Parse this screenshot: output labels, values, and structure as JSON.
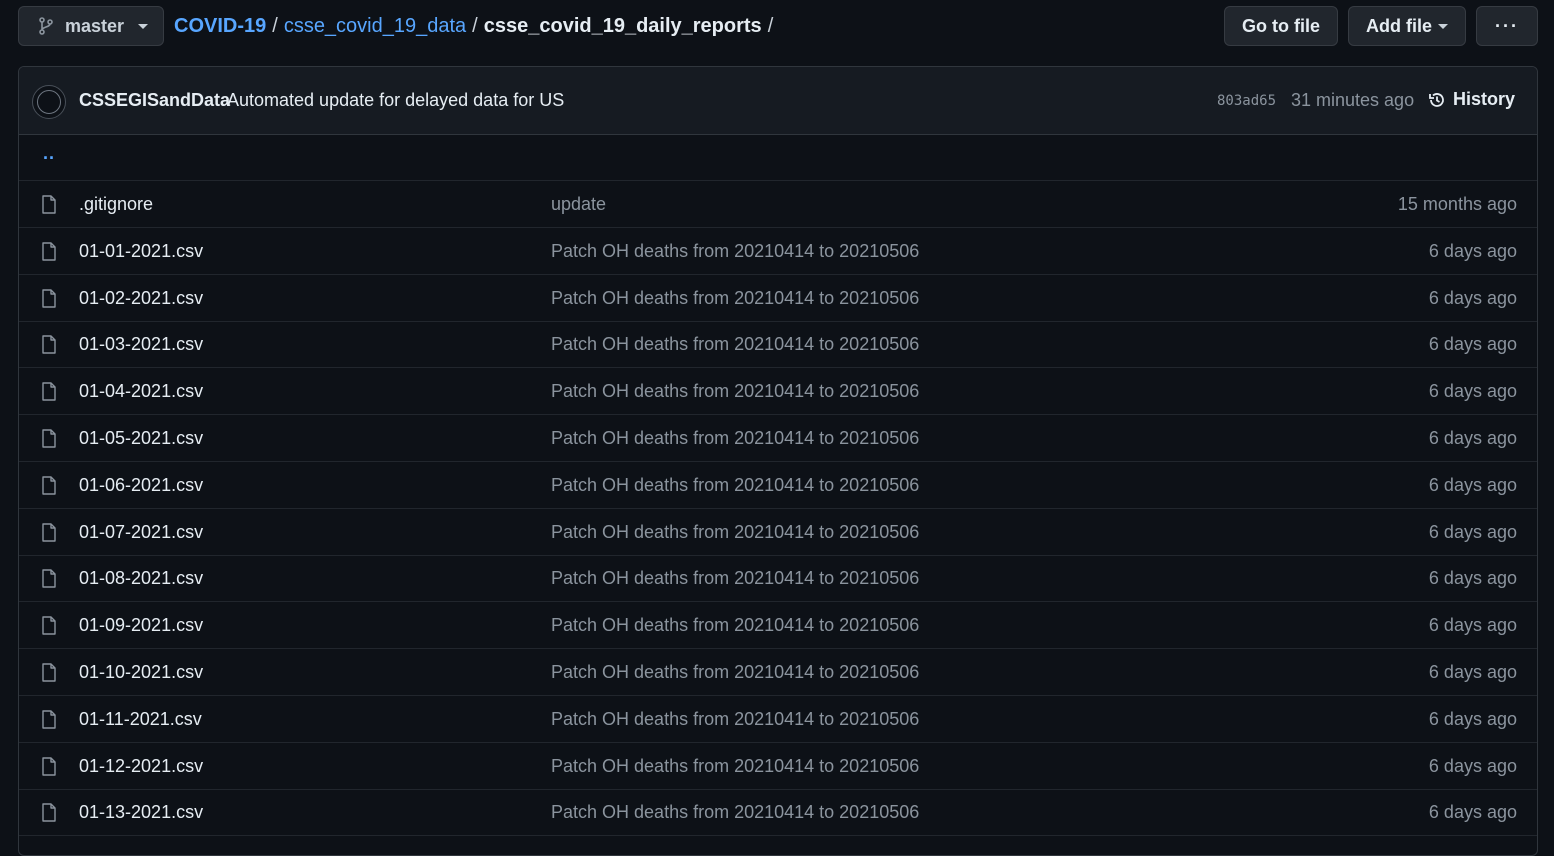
{
  "toolbar": {
    "branch": "master",
    "breadcrumb": {
      "root": "COVID-19",
      "folder": "csse_covid_19_data",
      "current": "csse_covid_19_daily_reports",
      "separator": "/"
    },
    "go_to_file": "Go to file",
    "add_file": "Add file",
    "more": "···"
  },
  "commit": {
    "author": "CSSEGISandData",
    "message": "Automated update for delayed data for US",
    "sha": "803ad65",
    "time": "31 minutes ago",
    "history": "History"
  },
  "parent_link": "..",
  "files": [
    {
      "name": ".gitignore",
      "message": "update",
      "age": "15 months ago"
    },
    {
      "name": "01-01-2021.csv",
      "message": "Patch OH deaths from 20210414 to 20210506",
      "age": "6 days ago"
    },
    {
      "name": "01-02-2021.csv",
      "message": "Patch OH deaths from 20210414 to 20210506",
      "age": "6 days ago"
    },
    {
      "name": "01-03-2021.csv",
      "message": "Patch OH deaths from 20210414 to 20210506",
      "age": "6 days ago"
    },
    {
      "name": "01-04-2021.csv",
      "message": "Patch OH deaths from 20210414 to 20210506",
      "age": "6 days ago"
    },
    {
      "name": "01-05-2021.csv",
      "message": "Patch OH deaths from 20210414 to 20210506",
      "age": "6 days ago"
    },
    {
      "name": "01-06-2021.csv",
      "message": "Patch OH deaths from 20210414 to 20210506",
      "age": "6 days ago"
    },
    {
      "name": "01-07-2021.csv",
      "message": "Patch OH deaths from 20210414 to 20210506",
      "age": "6 days ago"
    },
    {
      "name": "01-08-2021.csv",
      "message": "Patch OH deaths from 20210414 to 20210506",
      "age": "6 days ago"
    },
    {
      "name": "01-09-2021.csv",
      "message": "Patch OH deaths from 20210414 to 20210506",
      "age": "6 days ago"
    },
    {
      "name": "01-10-2021.csv",
      "message": "Patch OH deaths from 20210414 to 20210506",
      "age": "6 days ago"
    },
    {
      "name": "01-11-2021.csv",
      "message": "Patch OH deaths from 20210414 to 20210506",
      "age": "6 days ago"
    },
    {
      "name": "01-12-2021.csv",
      "message": "Patch OH deaths from 20210414 to 20210506",
      "age": "6 days ago"
    },
    {
      "name": "01-13-2021.csv",
      "message": "Patch OH deaths from 20210414 to 20210506",
      "age": "6 days ago"
    }
  ]
}
